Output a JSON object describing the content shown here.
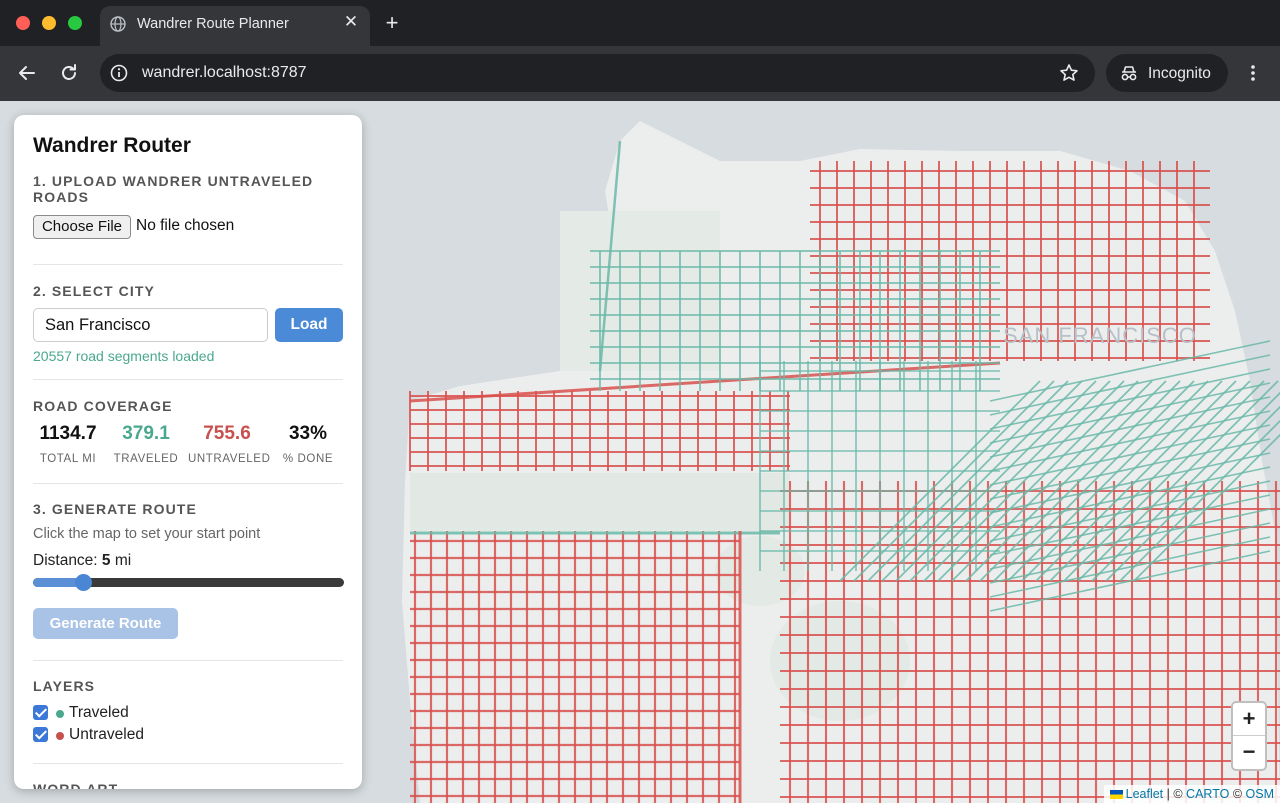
{
  "browser": {
    "tab_title": "Wandrer Route Planner",
    "url": "wandrer.localhost:8787",
    "profile_label": "Incognito"
  },
  "panel": {
    "title": "Wandrer Router",
    "upload": {
      "heading": "1. UPLOAD WANDRER UNTRAVELED ROADS",
      "button_label": "Choose File",
      "status": "No file chosen"
    },
    "city": {
      "heading": "2. SELECT CITY",
      "input_value": "San Francisco",
      "load_label": "Load",
      "status": "20557 road segments loaded"
    },
    "coverage": {
      "heading": "ROAD COVERAGE",
      "stats": [
        {
          "value": "1134.7",
          "label": "TOTAL MI",
          "color": "#111111"
        },
        {
          "value": "379.1",
          "label": "TRAVELED",
          "color": "#4aa88f"
        },
        {
          "value": "755.6",
          "label": "UNTRAVELED",
          "color": "#c8504e"
        },
        {
          "value": "33%",
          "label": "% DONE",
          "color": "#111111"
        }
      ]
    },
    "route": {
      "heading": "3. GENERATE ROUTE",
      "hint": "Click the map to set your start point",
      "distance_prefix": "Distance: ",
      "distance_value": "5",
      "distance_unit": " mi",
      "slider_fraction": 0.16,
      "generate_label": "Generate Route"
    },
    "layers": {
      "heading": "LAYERS",
      "items": [
        {
          "label": "Traveled",
          "color": "#4aa88f",
          "checked": true
        },
        {
          "label": "Untraveled",
          "color": "#c8504e",
          "checked": true
        }
      ]
    },
    "word_art": {
      "heading": "WORD ART"
    }
  },
  "map": {
    "city_label": "SAN FRANCISCO",
    "traveled_color": "#6bb8a8",
    "untraveled_color": "#d9504e",
    "zoom_in": "+",
    "zoom_out": "−",
    "attribution": {
      "leaflet": "Leaflet",
      "sep": " | © ",
      "carto": "CARTO",
      "sep2": " © ",
      "osm": "OSM"
    }
  }
}
